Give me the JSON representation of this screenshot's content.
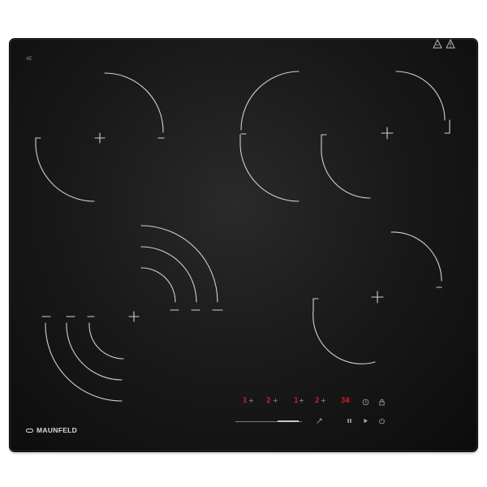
{
  "product": {
    "brand": "MAUNFELD",
    "top_label": "4E"
  },
  "display": {
    "zone_levels": [
      {
        "digit": "1",
        "control": "+"
      },
      {
        "digit": "2",
        "control": "+"
      },
      {
        "digit": "1",
        "control": "+"
      },
      {
        "digit": "2",
        "control": "+"
      }
    ],
    "timer": "34"
  },
  "icons": {
    "warning_left": "hot-surface-warning-icon",
    "warning_right": "warning-icon",
    "timer": "clock-icon",
    "lock": "lock-icon",
    "boost": "booster-icon",
    "pause": "pause-icon",
    "play": "play-icon",
    "power": "power-icon"
  },
  "colors": {
    "glass": "#141414",
    "line": "#d0d0d0",
    "display_red": "#e0242a"
  },
  "power_slider": {
    "level_fraction": 0.95
  }
}
